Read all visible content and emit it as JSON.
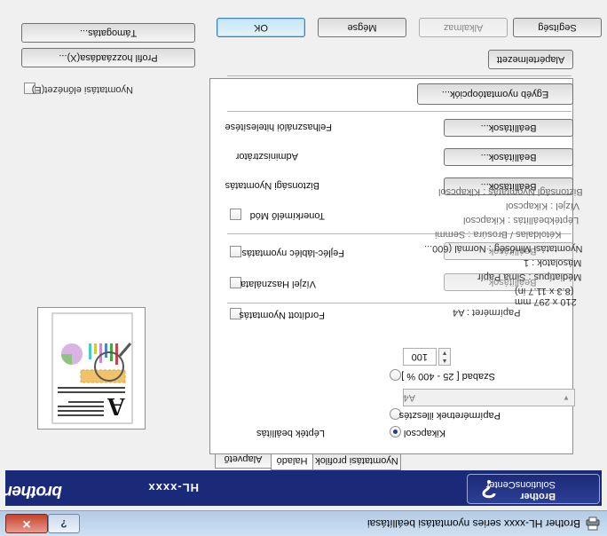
{
  "window": {
    "title": "Brother HL-xxxx series nyomtatási beállításai",
    "help_symbol": "?",
    "close_symbol": "✕"
  },
  "brand": {
    "logo": "brother",
    "model": "HL-xxxx",
    "solutions_center_line1": "Brother",
    "solutions_center_line2": "SolutionsCenter"
  },
  "tabs": [
    {
      "label": "Alapvető",
      "active": false
    },
    {
      "label": "Haladó",
      "active": true
    },
    {
      "label": "Nyomtatási profilok",
      "active": false
    }
  ],
  "advanced": {
    "scaling_label": "Lépték",
    "scaling_label_full": "Lépték beállítás",
    "scaling_options": [
      "Kikapcsol",
      "Papírméretnek illesztés",
      "Szabad [ 25 - 400 % ]"
    ],
    "scaling_selected": "Kikapcsol",
    "paper_fit_value": "A4",
    "free_value": "100",
    "reverse_print": "Fordított Nyomtatás",
    "use_watermark": "Vízjel Használata",
    "header_footer": "Fejléc-lábléc nyomtatás",
    "toner_save": "Tonerkímélő Mód",
    "secure_print": "Biztonsági Nyomtatás",
    "administrator": "Adminisztrátor",
    "user_auth": "Felhasználói hitelesítése",
    "settings_button": "Beállítások...",
    "other_options_button": "Egyéb nyomtatóopciók...",
    "default_button": "Alapértelmezett"
  },
  "summary": {
    "lines": [
      "Papírméret : A4",
      "210 x 297 mm",
      "(8.3 x 11.7 in)",
      "Médiatípus : Sima Papír",
      "Másolatok : 1",
      "Nyomtatási Minőség : Normál (600...",
      "Kétoldalas / Brosúra : Semmi",
      "Léptékbeállítás : Kikapcsol",
      "Vízjel : Kikapcsol",
      "Biztonsági Nyomtatás : Kikapcsol"
    ],
    "preview_checkbox": "Nyomtatási előnézet(E)",
    "add_profile_button": "Profil hozzáadása(X)...",
    "support_button": "Támogatás..."
  },
  "bottom_buttons": {
    "ok": "OK",
    "cancel": "Mégse",
    "apply": "Alkalmaz",
    "help": "Segítség"
  },
  "colors": {
    "brand_blue": "#1b2a78",
    "summary_blue": "#1e3a7a"
  }
}
